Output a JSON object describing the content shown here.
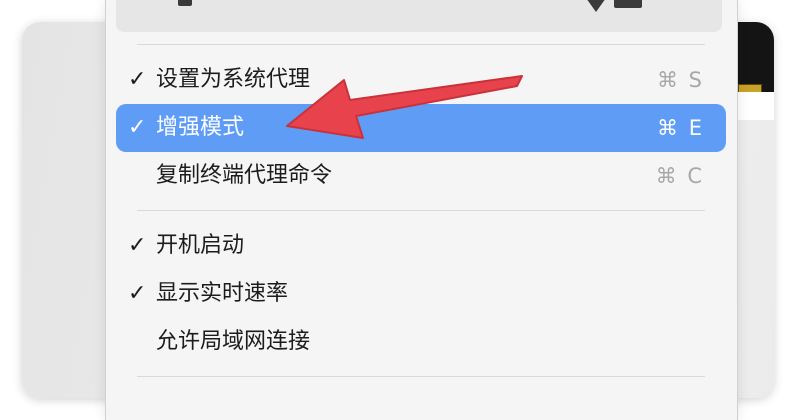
{
  "menu": {
    "items": [
      {
        "label": "设置为系统代理",
        "checked": true,
        "shortcut": "⌘ S",
        "highlighted": false
      },
      {
        "label": "增强模式",
        "checked": true,
        "shortcut": "⌘ E",
        "highlighted": true
      },
      {
        "label": "复制终端代理命令",
        "checked": false,
        "shortcut": "⌘ C",
        "highlighted": false
      },
      {
        "label": "开机启动",
        "checked": true,
        "shortcut": "",
        "highlighted": false
      },
      {
        "label": "显示实时速率",
        "checked": true,
        "shortcut": "",
        "highlighted": false
      },
      {
        "label": "允许局域网连接",
        "checked": false,
        "shortcut": "",
        "highlighted": false
      }
    ],
    "check_glyph": "✓"
  },
  "colors": {
    "highlight": "#5f9cf5",
    "arrow": "#e8434d",
    "menu_background": "#f5f5f5"
  },
  "icons": {
    "check": "checkmark-icon",
    "annotation": "red-arrow-annotation"
  }
}
